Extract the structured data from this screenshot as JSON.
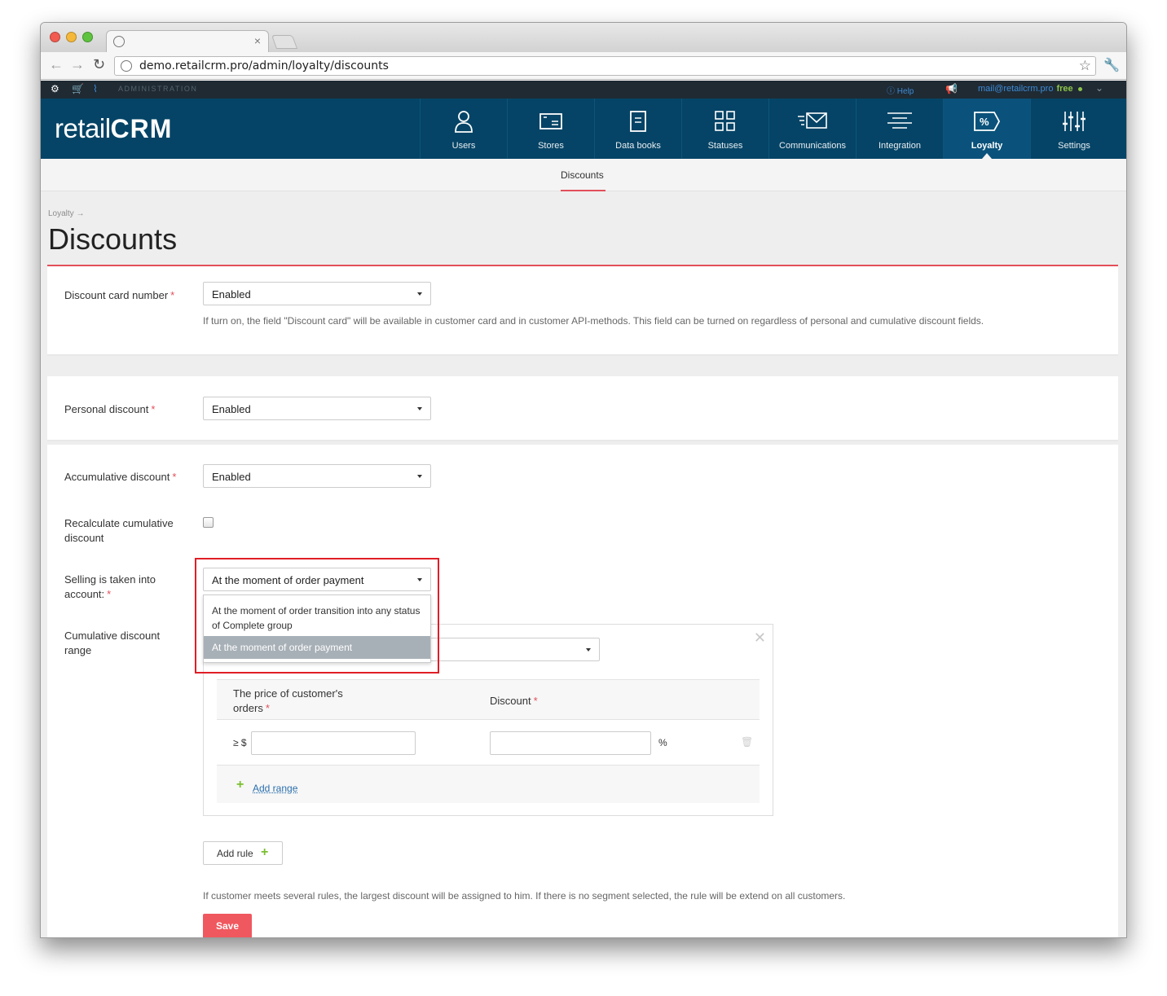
{
  "browser": {
    "url": "demo.retailcrm.pro/admin/loyalty/discounts"
  },
  "adminbar": {
    "section": "ADMINISTRATION",
    "help": "Help",
    "email": "mail@retailcrm.pro",
    "plan": "free"
  },
  "logo": {
    "part1": "retail",
    "part2": "CRM"
  },
  "nav": {
    "items": [
      {
        "label": "Users",
        "icon": "user-icon"
      },
      {
        "label": "Stores",
        "icon": "store-icon"
      },
      {
        "label": "Data books",
        "icon": "book-icon"
      },
      {
        "label": "Statuses",
        "icon": "statuses-icon"
      },
      {
        "label": "Communications",
        "icon": "envelope-icon"
      },
      {
        "label": "Integration",
        "icon": "integration-icon"
      },
      {
        "label": "Loyalty",
        "icon": "percent-tag-icon"
      },
      {
        "label": "Settings",
        "icon": "sliders-icon"
      }
    ],
    "active": "Loyalty"
  },
  "subnav": {
    "tab": "Discounts"
  },
  "page": {
    "breadcrumb": "Loyalty →",
    "title": "Discounts"
  },
  "form": {
    "discount_card": {
      "label": "Discount card number",
      "value": "Enabled",
      "hint": "If turn on, the field \"Discount card\" will be available in customer card and in customer API-methods. This field can be turned on regardless of personal and cumulative discount fields."
    },
    "personal": {
      "label": "Personal discount",
      "value": "Enabled"
    },
    "accumulative": {
      "label": "Accumulative discount",
      "value": "Enabled"
    },
    "recalculate": {
      "label_line1": "Recalculate cumulative",
      "label_line2": "discount",
      "checked": false
    },
    "selling": {
      "label_line1": "Selling is taken into",
      "label_line2": "account:",
      "value": "At the moment of order payment",
      "options": [
        "At the moment of order transition into any status of Complete group",
        "At the moment of order payment"
      ],
      "selected_index": 1
    },
    "range": {
      "label_line1": "Cumulative discount",
      "label_line2": "range",
      "col_price_line1": "The price of customer's",
      "col_price_line2": "orders",
      "col_discount": "Discount",
      "prefix": "≥ $",
      "suffix": "%",
      "add_range": "Add range"
    },
    "add_rule": "Add rule",
    "rules_hint": "If customer meets several rules, the largest discount will be assigned to him. If there is no segment selected, the rule will be extend on all customers.",
    "save": "Save"
  },
  "colors": {
    "nav_bg": "#054466",
    "accent_red": "#e24f5a",
    "save_bg": "#f0585f",
    "link": "#2a6fad",
    "plus": "#7bbf2f"
  }
}
